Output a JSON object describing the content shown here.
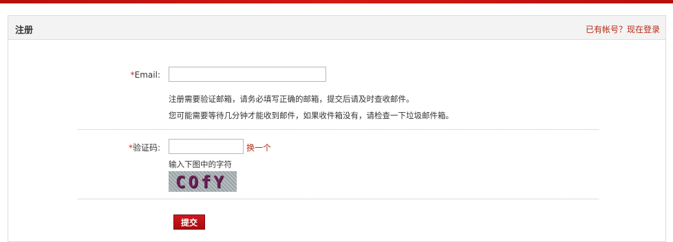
{
  "header": {
    "title": "注册",
    "login_link": "已有帐号？现在登录"
  },
  "form": {
    "email": {
      "required_mark": "*",
      "label": "Email:",
      "value": "",
      "placeholder": ""
    },
    "hints": [
      "注册需要验证邮箱，请务必填写正确的邮箱，提交后请及时查收邮件。",
      "您可能需要等待几分钟才能收到邮件，如果收件箱没有，请检查一下垃圾邮件箱。"
    ],
    "captcha": {
      "required_mark": "*",
      "label": "验证码:",
      "value": "",
      "refresh_label": "换一个",
      "instruction": "输入下图中的字符",
      "image_text": "COfY"
    },
    "submit_label": "提交"
  },
  "colors": {
    "brand_red": "#c0282d",
    "link_red": "#b72a16"
  }
}
